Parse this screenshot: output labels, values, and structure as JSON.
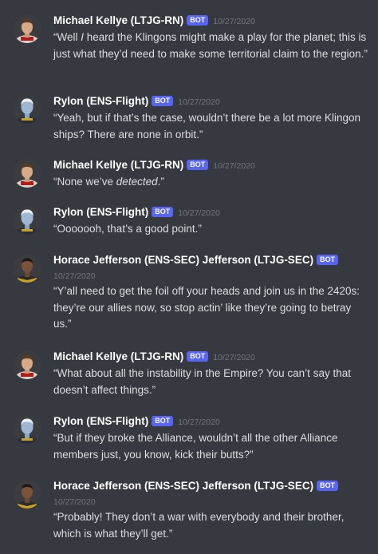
{
  "messages": [
    {
      "author": "Michael Kellye (LTJG-RN)",
      "bot_tag": "BOT",
      "timestamp": "10/27/2020",
      "text_before": "“Well ",
      "text_em": "I",
      "text_after": " heard the Klingons might make a play for the planet; this is just what they’d need to make some territorial claim to the region.”",
      "avatar": "human-officer-avatar"
    },
    {
      "author": "Rylon (ENS-Flight)",
      "bot_tag": "BOT",
      "timestamp": "10/27/2020",
      "text_before": "“Yeah, but if that’s the case, wouldn’t there be a lot more Klingon ships? There are none in orbit.”",
      "text_em": "",
      "text_after": "",
      "avatar": "andorian-officer-avatar"
    },
    {
      "author": "Michael Kellye (LTJG-RN)",
      "bot_tag": "BOT",
      "timestamp": "10/27/2020",
      "text_before": "“None we’ve ",
      "text_em": "detected",
      "text_after": ".”",
      "avatar": "human-officer-avatar"
    },
    {
      "author": "Rylon (ENS-Flight)",
      "bot_tag": "BOT",
      "timestamp": "10/27/2020",
      "text_before": "“Ooooooh, that’s a good point.”",
      "text_em": "",
      "text_after": "",
      "avatar": "andorian-officer-avatar"
    },
    {
      "author": "Horace Jefferson (ENS-SEC) Jefferson (LTJG-SEC)",
      "bot_tag": "BOT",
      "timestamp": "10/27/2020",
      "text_before": "“Y’all need to get the foil off your heads and join us in the 2420s: they’re our allies now, so stop actin’ like they’re going to betray us.”",
      "text_em": "",
      "text_after": "",
      "avatar": "security-officer-avatar"
    },
    {
      "author": "Michael Kellye (LTJG-RN)",
      "bot_tag": "BOT",
      "timestamp": "10/27/2020",
      "text_before": "“What about all the instability in the Empire? You can’t say that doesn’t affect things.”",
      "text_em": "",
      "text_after": "",
      "avatar": "human-officer-avatar"
    },
    {
      "author": "Rylon (ENS-Flight)",
      "bot_tag": "BOT",
      "timestamp": "10/27/2020",
      "text_before": "“But if they broke the Alliance, wouldn’t all the other Alliance members just, you know, kick their butts?”",
      "text_em": "",
      "text_after": "",
      "avatar": "andorian-officer-avatar"
    },
    {
      "author": "Horace Jefferson (ENS-SEC) Jefferson (LTJG-SEC)",
      "bot_tag": "BOT",
      "timestamp": "10/27/2020",
      "text_before": "“Probably! They don’t a war with everybody and their brother, which is what they’ll get.”",
      "text_em": "",
      "text_after": "",
      "avatar": "security-officer-avatar"
    }
  ],
  "colors": {
    "background": "#36393f",
    "username": "#ffffff",
    "text": "#dcddde",
    "timestamp": "#72767d",
    "bot_tag": "#5865f2"
  }
}
